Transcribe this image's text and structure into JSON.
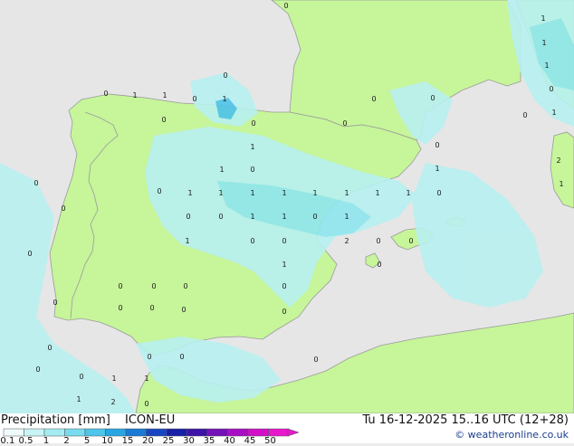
{
  "map": {
    "colors": {
      "sea": "#e6e6e6",
      "land": "#c6f59a",
      "border": "#9a9a9a",
      "precip_light": "#b8f0f0",
      "precip_medium": "#8fe6ee",
      "precip_strong": "#4fc3ea",
      "precip_heavy": "#2a72d8"
    },
    "labels": [
      {
        "text": "0"
      },
      {
        "text": "1"
      },
      {
        "text": "1"
      },
      {
        "text": "0"
      },
      {
        "text": "1"
      },
      {
        "text": "0"
      },
      {
        "text": "0"
      },
      {
        "text": "0"
      },
      {
        "text": "0"
      },
      {
        "text": "0"
      },
      {
        "text": "0"
      },
      {
        "text": "1"
      },
      {
        "text": "0"
      },
      {
        "text": "1"
      },
      {
        "text": "0"
      },
      {
        "text": "1"
      },
      {
        "text": "1"
      },
      {
        "text": "1"
      },
      {
        "text": "1"
      },
      {
        "text": "1"
      },
      {
        "text": "1"
      },
      {
        "text": "1"
      },
      {
        "text": "1"
      },
      {
        "text": "0"
      },
      {
        "text": "0"
      },
      {
        "text": "1"
      },
      {
        "text": "1"
      },
      {
        "text": "0"
      },
      {
        "text": "1"
      },
      {
        "text": "1"
      },
      {
        "text": "2"
      },
      {
        "text": "1"
      },
      {
        "text": "0"
      },
      {
        "text": "0"
      },
      {
        "text": "1"
      },
      {
        "text": "0"
      },
      {
        "text": "0"
      },
      {
        "text": "0"
      },
      {
        "text": "0"
      },
      {
        "text": "0"
      },
      {
        "text": "0"
      },
      {
        "text": "0"
      },
      {
        "text": "0"
      },
      {
        "text": "0"
      },
      {
        "text": "0"
      },
      {
        "text": "0"
      },
      {
        "text": "1"
      },
      {
        "text": "1"
      },
      {
        "text": "0"
      },
      {
        "text": "1"
      },
      {
        "text": "0"
      },
      {
        "text": "0"
      },
      {
        "text": "0"
      },
      {
        "text": "1"
      },
      {
        "text": "2"
      },
      {
        "text": "1"
      },
      {
        "text": "0"
      },
      {
        "text": "1"
      },
      {
        "text": "0"
      },
      {
        "text": "1"
      },
      {
        "text": "1"
      },
      {
        "text": "2"
      },
      {
        "text": "0"
      },
      {
        "text": "0"
      },
      {
        "text": "0"
      },
      {
        "text": "0"
      },
      {
        "text": "0"
      },
      {
        "text": "0"
      },
      {
        "text": "0"
      },
      {
        "text": "0"
      },
      {
        "text": "0"
      },
      {
        "text": "0"
      }
    ]
  },
  "footer": {
    "title": "Precipitation [mm]",
    "model": "ICON-EU",
    "datetime": "Tu 16-12-2025 15..16 UTC (12+28)",
    "credit": "© weatheronline.co.uk",
    "scale_ticks": [
      "0.1",
      "0.5",
      "1",
      "2",
      "5",
      "10",
      "15",
      "20",
      "25",
      "30",
      "35",
      "40",
      "45",
      "50"
    ],
    "scale_colors": [
      "#f0fcfc",
      "#c8f4f6",
      "#a4ecf2",
      "#78dcee",
      "#4cc6ea",
      "#28a6e2",
      "#1a7ad6",
      "#1846c2",
      "#1820a8",
      "#3c12a8",
      "#7410b8",
      "#a80ec4",
      "#d20ec8",
      "#e818cc"
    ]
  }
}
